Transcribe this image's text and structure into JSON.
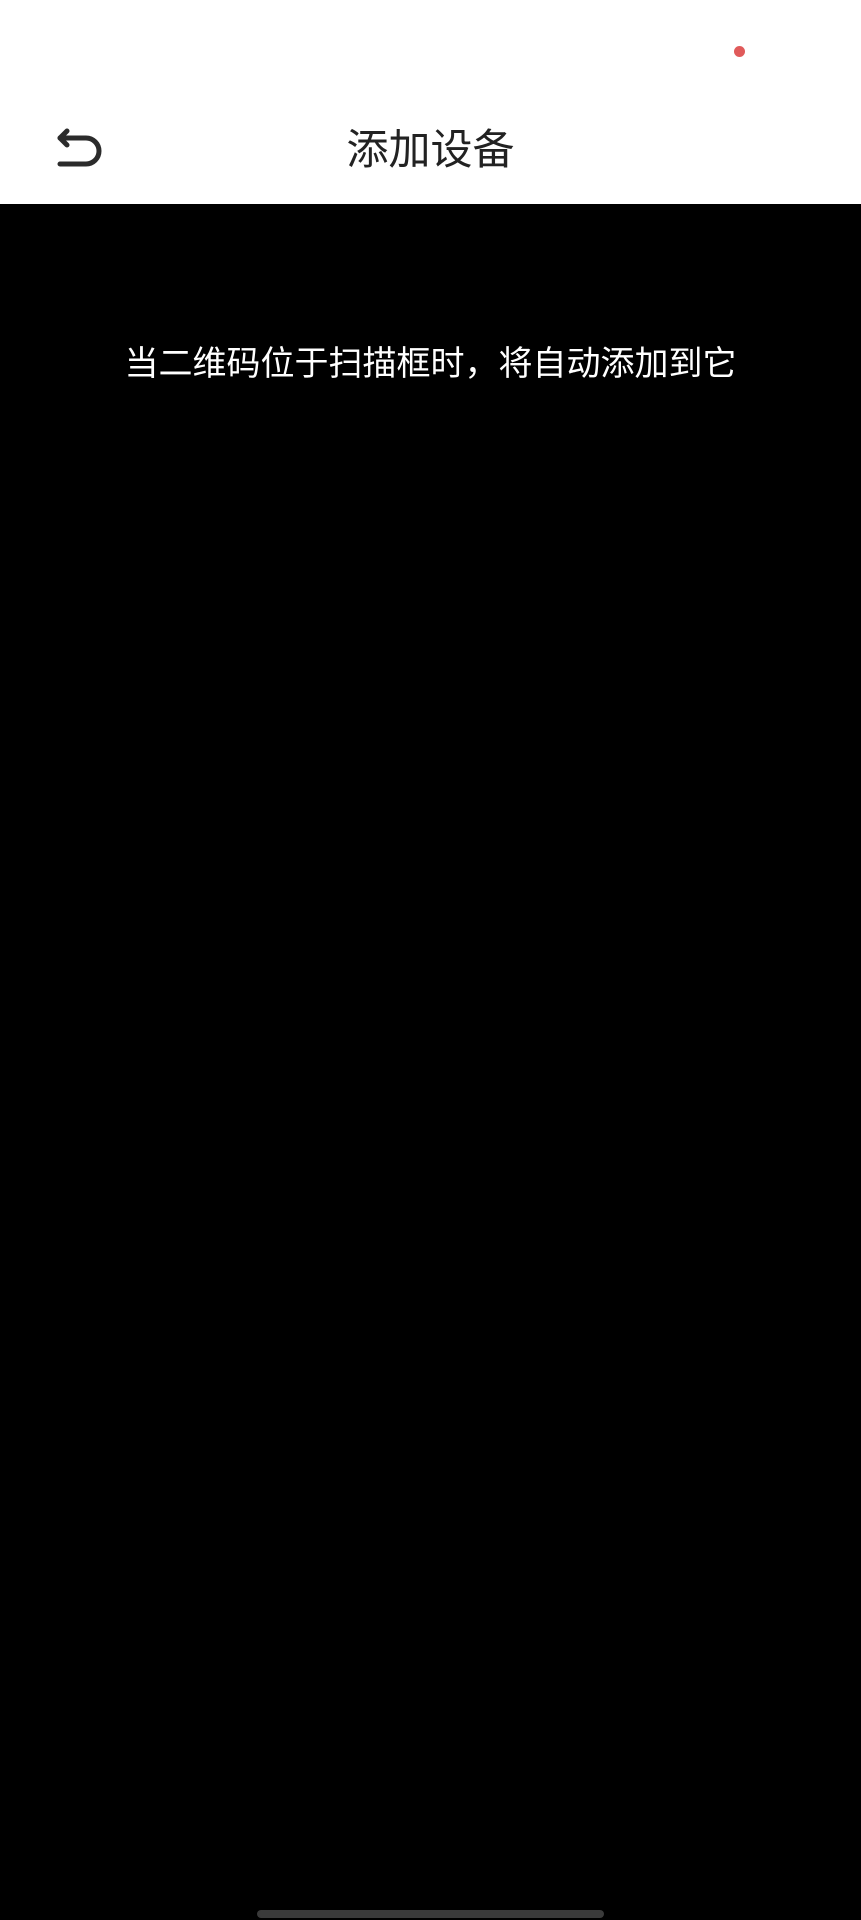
{
  "header": {
    "title": "添加设备",
    "back_icon": "back-arrow-icon"
  },
  "status_bar": {
    "indicator_color": "#e05a5a"
  },
  "scanner": {
    "hint": "当二维码位于扫描框时，将自动添加到它"
  },
  "colors": {
    "header_bg": "#ffffff",
    "scanner_bg": "#000000",
    "title_text": "#222222",
    "hint_text": "#ffffff"
  }
}
